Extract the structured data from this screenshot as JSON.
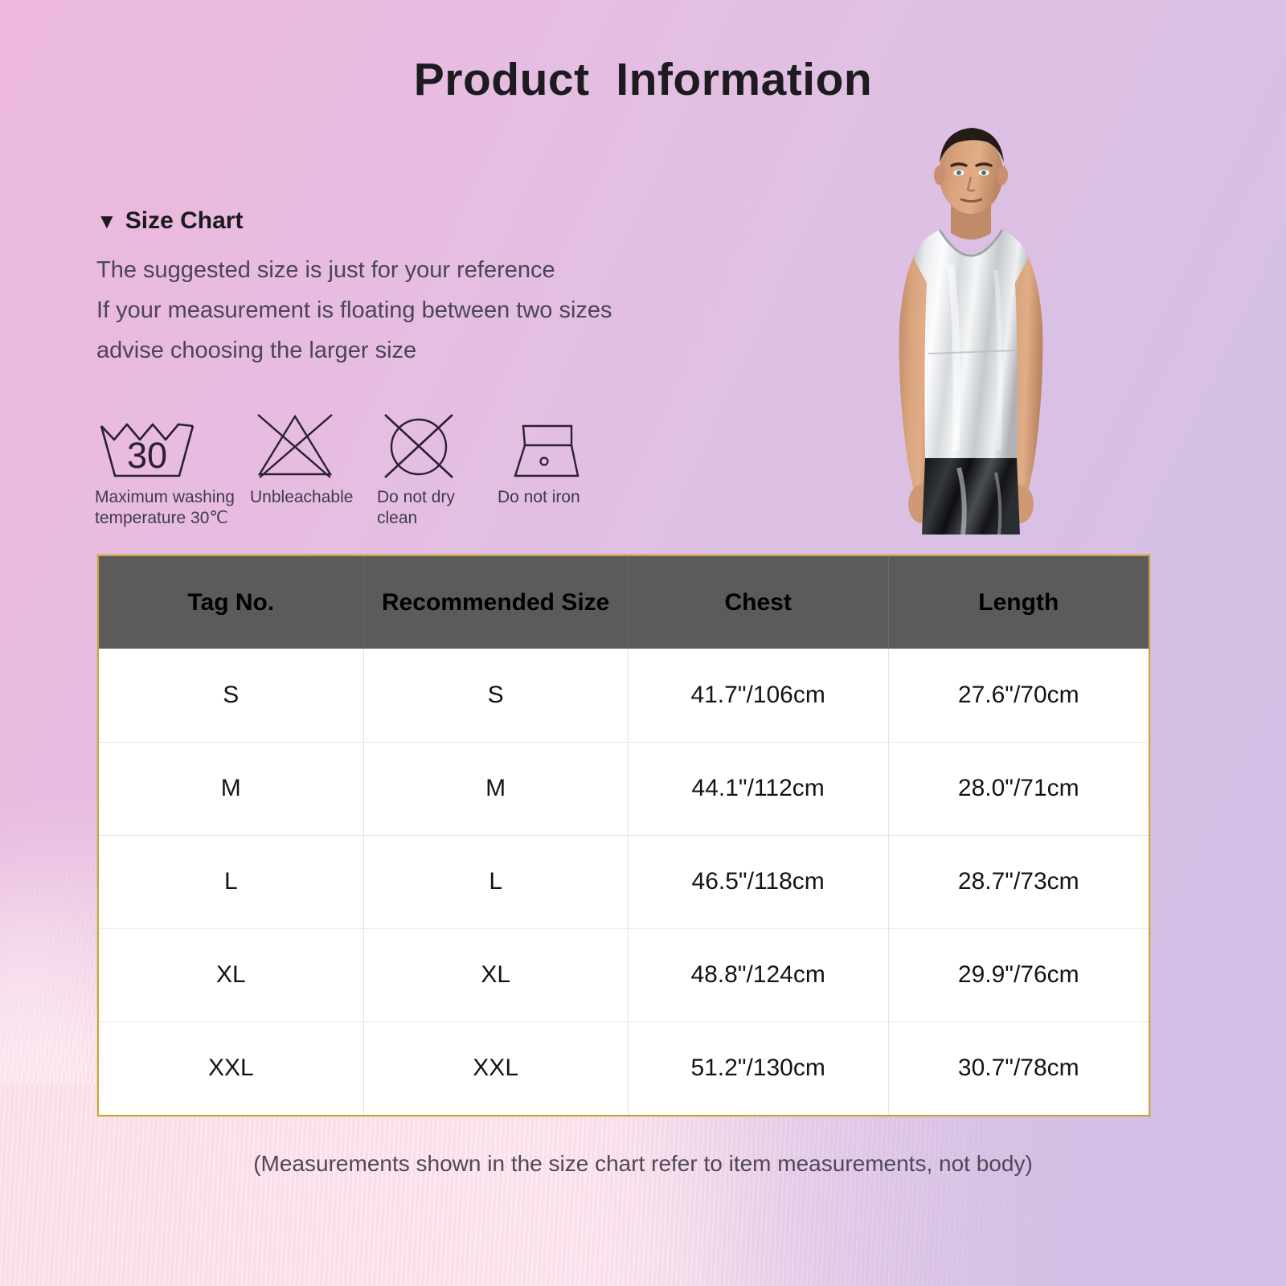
{
  "page": {
    "title": "Product  Information",
    "footer_note": "(Measurements shown in the size chart refer to item measurements, not body)"
  },
  "size_chart": {
    "caret": "▼",
    "heading": "Size Chart",
    "description_lines": [
      "The suggested size is just for your reference",
      "If your measurement is floating between two sizes",
      "advise choosing the larger size"
    ]
  },
  "care_symbols": [
    {
      "icon": "wash-tub-30-icon",
      "caption": "Maximum washing\ntemperature 30℃",
      "value": "30"
    },
    {
      "icon": "do-not-bleach-icon",
      "caption": "Unbleachable"
    },
    {
      "icon": "do-not-dry-clean-icon",
      "caption": "Do not dry clean"
    },
    {
      "icon": "do-not-iron-icon",
      "caption": "Do not iron"
    }
  ],
  "table": {
    "headers": [
      "Tag No.",
      "Recommended Size",
      "Chest",
      "Length"
    ],
    "rows": [
      [
        "S",
        "S",
        "41.7\"/106cm",
        "27.6\"/70cm"
      ],
      [
        "M",
        "M",
        "44.1\"/112cm",
        "28.0\"/71cm"
      ],
      [
        "L",
        "L",
        "46.5\"/118cm",
        "28.7\"/73cm"
      ],
      [
        "XL",
        "XL",
        "48.8\"/124cm",
        "29.9\"/76cm"
      ],
      [
        "XXL",
        "XXL",
        "51.2\"/130cm",
        "30.7\"/78cm"
      ]
    ]
  },
  "product_photo": {
    "alt": "Male model wearing silver metallic sleeveless tank top and black vinyl shorts"
  },
  "colors": {
    "bg_start": "#ecb8dd",
    "bg_end": "#d2bee6",
    "table_border": "#c7a53a",
    "table_header_bg": "#5b5b5b",
    "body_text": "#4b4554",
    "title_text": "#1d1b20"
  }
}
